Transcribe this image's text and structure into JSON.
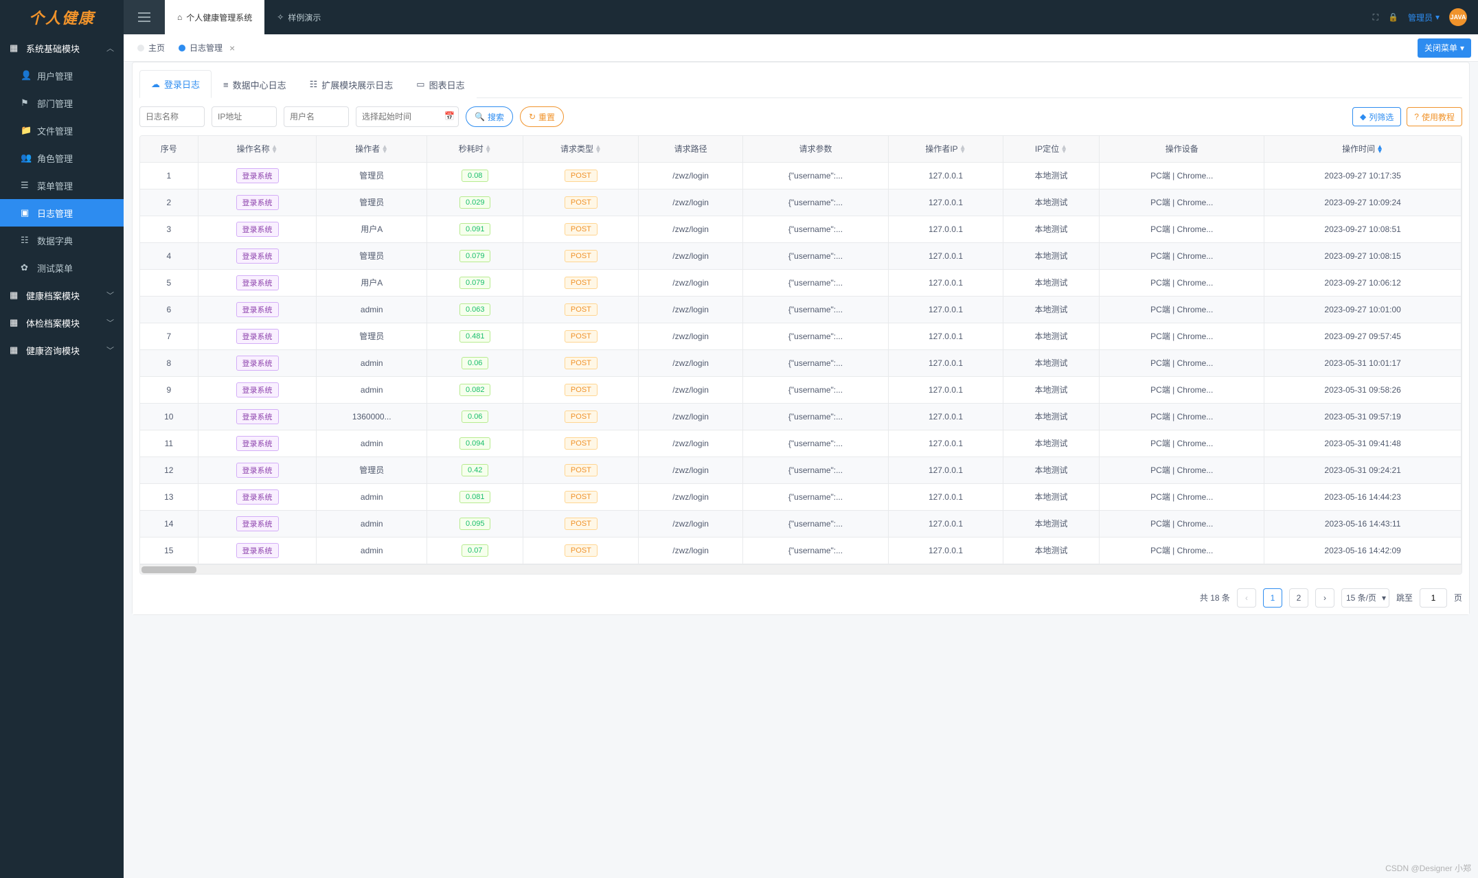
{
  "brand": "个人健康",
  "topNav": [
    {
      "label": "个人健康管理系统",
      "icon": "home"
    },
    {
      "label": "样例演示",
      "icon": "sparkle"
    }
  ],
  "adminLabel": "管理员",
  "javaBadge": "JAVA",
  "sidebar": {
    "groups": [
      {
        "label": "系统基础模块",
        "expanded": true,
        "items": [
          {
            "label": "用户管理",
            "active": false
          },
          {
            "label": "部门管理",
            "active": false
          },
          {
            "label": "文件管理",
            "active": false
          },
          {
            "label": "角色管理",
            "active": false
          },
          {
            "label": "菜单管理",
            "active": false
          },
          {
            "label": "日志管理",
            "active": true
          },
          {
            "label": "数据字典",
            "active": false
          },
          {
            "label": "测试菜单",
            "active": false
          }
        ]
      },
      {
        "label": "健康档案模块",
        "expanded": false
      },
      {
        "label": "体检档案模块",
        "expanded": false
      },
      {
        "label": "健康咨询模块",
        "expanded": false
      }
    ]
  },
  "tabs": [
    {
      "label": "主页",
      "active": false,
      "closable": false
    },
    {
      "label": "日志管理",
      "active": true,
      "closable": true
    }
  ],
  "closeMenuLabel": "关闭菜单",
  "innerTabs": [
    {
      "label": "登录日志",
      "active": true
    },
    {
      "label": "数据中心日志",
      "active": false
    },
    {
      "label": "扩展模块展示日志",
      "active": false
    },
    {
      "label": "图表日志",
      "active": false
    }
  ],
  "filters": {
    "namePlaceholder": "日志名称",
    "ipPlaceholder": "IP地址",
    "userPlaceholder": "用户名",
    "datePlaceholder": "选择起始时间",
    "searchLabel": "搜索",
    "resetLabel": "重置",
    "columnFilterLabel": "列筛选",
    "tutorialLabel": "使用教程"
  },
  "columns": [
    "序号",
    "操作名称",
    "操作者",
    "秒耗时",
    "请求类型",
    "请求路径",
    "请求参数",
    "操作者IP",
    "IP定位",
    "操作设备",
    "操作时间"
  ],
  "rows": [
    {
      "idx": "1",
      "op": "登录系统",
      "user": "管理员",
      "sec": "0.08",
      "method": "POST",
      "path": "/zwz/login",
      "params": "{\"username\":...",
      "ip": "127.0.0.1",
      "loc": "本地测试",
      "device": "PC端 | Chrome...",
      "time": "2023-09-27 10:17:35"
    },
    {
      "idx": "2",
      "op": "登录系统",
      "user": "管理员",
      "sec": "0.029",
      "method": "POST",
      "path": "/zwz/login",
      "params": "{\"username\":...",
      "ip": "127.0.0.1",
      "loc": "本地测试",
      "device": "PC端 | Chrome...",
      "time": "2023-09-27 10:09:24"
    },
    {
      "idx": "3",
      "op": "登录系统",
      "user": "用户A",
      "sec": "0.091",
      "method": "POST",
      "path": "/zwz/login",
      "params": "{\"username\":...",
      "ip": "127.0.0.1",
      "loc": "本地测试",
      "device": "PC端 | Chrome...",
      "time": "2023-09-27 10:08:51"
    },
    {
      "idx": "4",
      "op": "登录系统",
      "user": "管理员",
      "sec": "0.079",
      "method": "POST",
      "path": "/zwz/login",
      "params": "{\"username\":...",
      "ip": "127.0.0.1",
      "loc": "本地测试",
      "device": "PC端 | Chrome...",
      "time": "2023-09-27 10:08:15"
    },
    {
      "idx": "5",
      "op": "登录系统",
      "user": "用户A",
      "sec": "0.079",
      "method": "POST",
      "path": "/zwz/login",
      "params": "{\"username\":...",
      "ip": "127.0.0.1",
      "loc": "本地测试",
      "device": "PC端 | Chrome...",
      "time": "2023-09-27 10:06:12"
    },
    {
      "idx": "6",
      "op": "登录系统",
      "user": "admin",
      "sec": "0.063",
      "method": "POST",
      "path": "/zwz/login",
      "params": "{\"username\":...",
      "ip": "127.0.0.1",
      "loc": "本地测试",
      "device": "PC端 | Chrome...",
      "time": "2023-09-27 10:01:00"
    },
    {
      "idx": "7",
      "op": "登录系统",
      "user": "管理员",
      "sec": "0.481",
      "method": "POST",
      "path": "/zwz/login",
      "params": "{\"username\":...",
      "ip": "127.0.0.1",
      "loc": "本地测试",
      "device": "PC端 | Chrome...",
      "time": "2023-09-27 09:57:45"
    },
    {
      "idx": "8",
      "op": "登录系统",
      "user": "admin",
      "sec": "0.06",
      "method": "POST",
      "path": "/zwz/login",
      "params": "{\"username\":...",
      "ip": "127.0.0.1",
      "loc": "本地测试",
      "device": "PC端 | Chrome...",
      "time": "2023-05-31 10:01:17"
    },
    {
      "idx": "9",
      "op": "登录系统",
      "user": "admin",
      "sec": "0.082",
      "method": "POST",
      "path": "/zwz/login",
      "params": "{\"username\":...",
      "ip": "127.0.0.1",
      "loc": "本地测试",
      "device": "PC端 | Chrome...",
      "time": "2023-05-31 09:58:26"
    },
    {
      "idx": "10",
      "op": "登录系统",
      "user": "1360000...",
      "sec": "0.06",
      "method": "POST",
      "path": "/zwz/login",
      "params": "{\"username\":...",
      "ip": "127.0.0.1",
      "loc": "本地测试",
      "device": "PC端 | Chrome...",
      "time": "2023-05-31 09:57:19"
    },
    {
      "idx": "11",
      "op": "登录系统",
      "user": "admin",
      "sec": "0.094",
      "method": "POST",
      "path": "/zwz/login",
      "params": "{\"username\":...",
      "ip": "127.0.0.1",
      "loc": "本地测试",
      "device": "PC端 | Chrome...",
      "time": "2023-05-31 09:41:48"
    },
    {
      "idx": "12",
      "op": "登录系统",
      "user": "管理员",
      "sec": "0.42",
      "method": "POST",
      "path": "/zwz/login",
      "params": "{\"username\":...",
      "ip": "127.0.0.1",
      "loc": "本地测试",
      "device": "PC端 | Chrome...",
      "time": "2023-05-31 09:24:21"
    },
    {
      "idx": "13",
      "op": "登录系统",
      "user": "admin",
      "sec": "0.081",
      "method": "POST",
      "path": "/zwz/login",
      "params": "{\"username\":...",
      "ip": "127.0.0.1",
      "loc": "本地测试",
      "device": "PC端 | Chrome...",
      "time": "2023-05-16 14:44:23"
    },
    {
      "idx": "14",
      "op": "登录系统",
      "user": "admin",
      "sec": "0.095",
      "method": "POST",
      "path": "/zwz/login",
      "params": "{\"username\":...",
      "ip": "127.0.0.1",
      "loc": "本地测试",
      "device": "PC端 | Chrome...",
      "time": "2023-05-16 14:43:11"
    },
    {
      "idx": "15",
      "op": "登录系统",
      "user": "admin",
      "sec": "0.07",
      "method": "POST",
      "path": "/zwz/login",
      "params": "{\"username\":...",
      "ip": "127.0.0.1",
      "loc": "本地测试",
      "device": "PC端 | Chrome...",
      "time": "2023-05-16 14:42:09"
    }
  ],
  "pagination": {
    "totalLabel": "共 18 条",
    "pages": [
      "1",
      "2"
    ],
    "currentPage": "1",
    "sizeLabel": "15 条/页",
    "jumpLabel": "跳至",
    "jumpValue": "1",
    "pageSuffix": "页"
  },
  "watermark": "CSDN @Designer 小郑"
}
